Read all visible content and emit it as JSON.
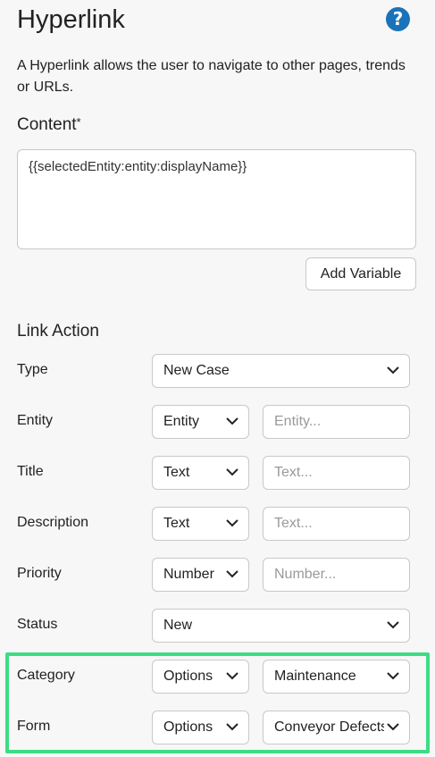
{
  "header": {
    "title": "Hyperlink",
    "help_glyph": "?"
  },
  "description": "A Hyperlink allows the user to navigate to other pages, trends or URLs.",
  "content": {
    "label": "Content",
    "required_mark": "*",
    "value": "{{selectedEntity:entity:displayName}}",
    "add_variable_label": "Add Variable"
  },
  "link_action": {
    "title": "Link Action",
    "type": {
      "label": "Type",
      "value": "New Case"
    },
    "entity": {
      "label": "Entity",
      "mode": "Entity",
      "placeholder": "Entity..."
    },
    "title_row": {
      "label": "Title",
      "mode": "Text",
      "placeholder": "Text..."
    },
    "description_row": {
      "label": "Description",
      "mode": "Text",
      "placeholder": "Text..."
    },
    "priority": {
      "label": "Priority",
      "mode": "Number",
      "placeholder": "Number..."
    },
    "status": {
      "label": "Status",
      "value": "New"
    },
    "category": {
      "label": "Category",
      "mode": "Options",
      "value": "Maintenance"
    },
    "form": {
      "label": "Form",
      "mode": "Options",
      "value": "Conveyor Defects"
    }
  },
  "colors": {
    "accent_help": "#1a73b8",
    "highlight": "#3ddc84"
  }
}
